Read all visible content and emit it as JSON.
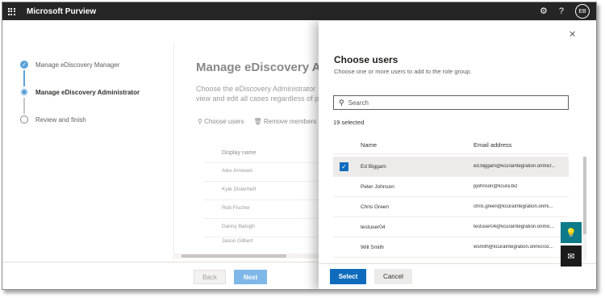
{
  "app": {
    "title": "Microsoft Purview"
  },
  "header": {
    "settings_icon": "gear-icon",
    "help_icon": "question-icon",
    "avatar_initials": "EB"
  },
  "wizard": {
    "steps": [
      {
        "label": "Manage eDiscovery Manager",
        "state": "done"
      },
      {
        "label": "Manage eDiscovery Administrator",
        "state": "current"
      },
      {
        "label": "Review and finish",
        "state": "todo"
      }
    ]
  },
  "main": {
    "title": "Manage eDiscovery Admir",
    "description_line1": "Choose the eDiscovery Administrator",
    "description_line2": "view and edit all cases regardless of p",
    "toolbar": {
      "choose_users": "Choose users",
      "remove_members": "Remove members"
    },
    "table": {
      "header": "Display name",
      "rows": [
        "Alex Arnesen",
        "Kyle Disterheft",
        "Rob Fischer",
        "Danny Balogh",
        "Jason Gilbert"
      ]
    },
    "back_label": "Back",
    "next_label": "Next"
  },
  "panel": {
    "title": "Choose users",
    "subtitle": "Choose one or more users to add to the role group.",
    "search_placeholder": "Search",
    "selected_count": "19 selected",
    "columns": {
      "name": "Name",
      "email": "Email address"
    },
    "rows": [
      {
        "name": "Ed Biggam",
        "email": "ed.biggam@kcuraIntegration.onmicr...",
        "selected": true
      },
      {
        "name": "Peter Johnson",
        "email": "pjohnson@kcura.biz",
        "selected": false
      },
      {
        "name": "Chris Green",
        "email": "chris.green@kcuraIntegration.onmi...",
        "selected": false
      },
      {
        "name": "testuser04",
        "email": "testuser04@kcuraIntegration.onmic...",
        "selected": false
      },
      {
        "name": "Will Smith",
        "email": "wsmith@kcuraIntegration.onmicros...",
        "selected": false
      }
    ],
    "select_label": "Select",
    "cancel_label": "Cancel"
  }
}
